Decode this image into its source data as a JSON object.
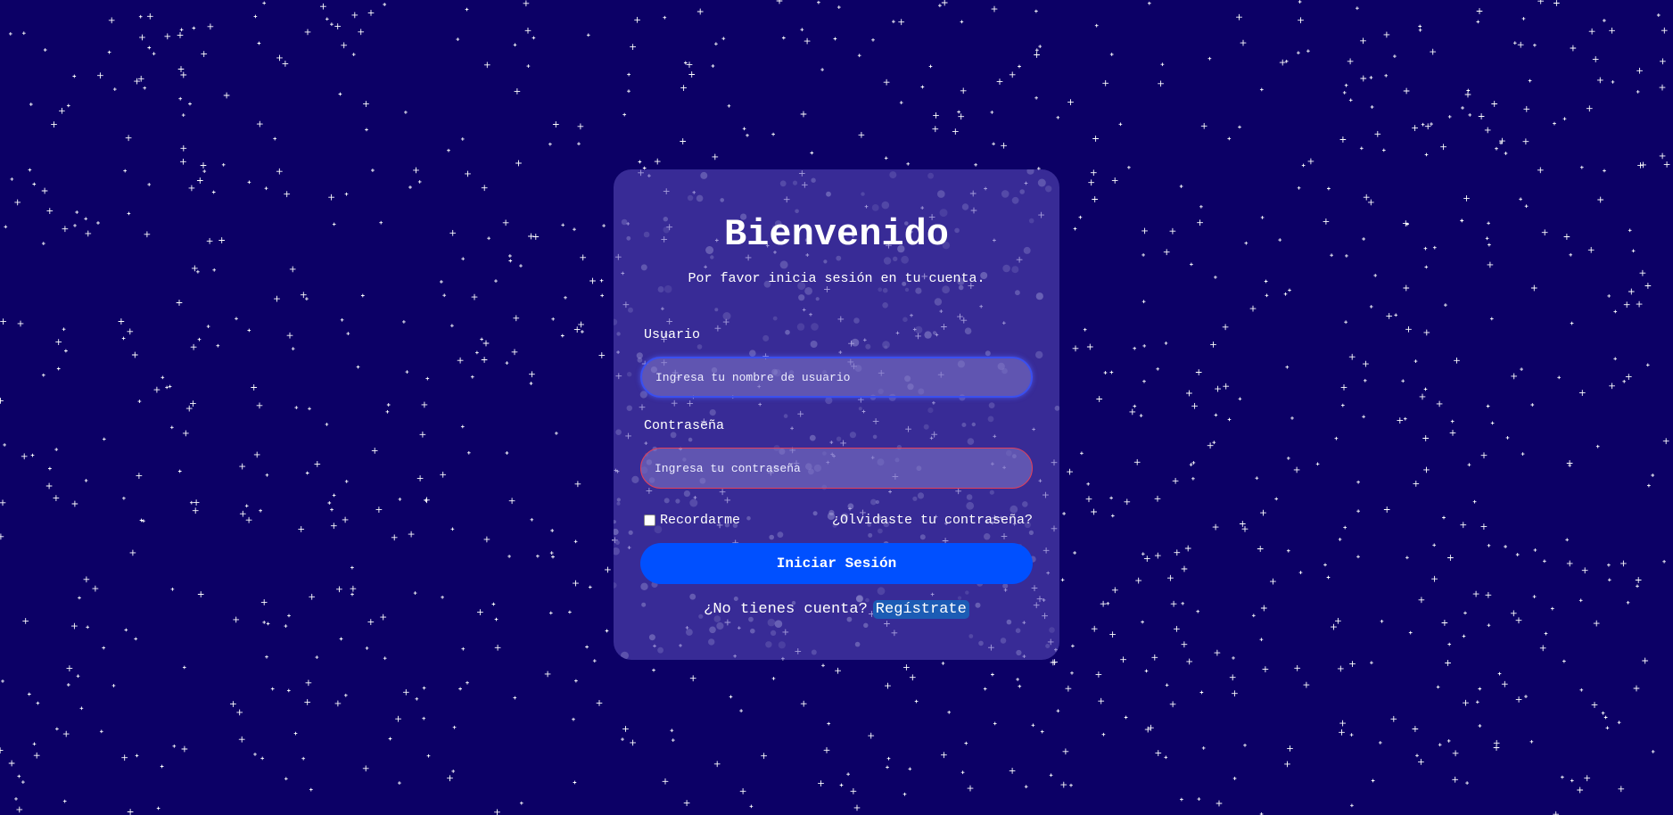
{
  "theme": {
    "background": "#0c0066",
    "card": "#4a3fa6",
    "accent": "#0050ff",
    "user_field_border": "#3a4ff0",
    "password_field_border": "#e0405a",
    "signup_highlight": "#1c5cb5"
  },
  "login": {
    "title": "Bienvenido",
    "subtitle": "Por favor inicia sesión en tu cuenta.",
    "username": {
      "label": "Usuario",
      "value": "",
      "placeholder": "Ingresa tu nombre de usuario"
    },
    "password": {
      "label": "Contraseña",
      "value": "",
      "placeholder": "Ingresa tu contraseña"
    },
    "remember_label": "Recordarme",
    "remember_checked": false,
    "forgot_label": "¿Olvidaste tu contraseña?",
    "submit_label": "Iniciar Sesión",
    "no_account_text": "¿No tienes cuenta?",
    "signup_label": "Regístrate"
  }
}
